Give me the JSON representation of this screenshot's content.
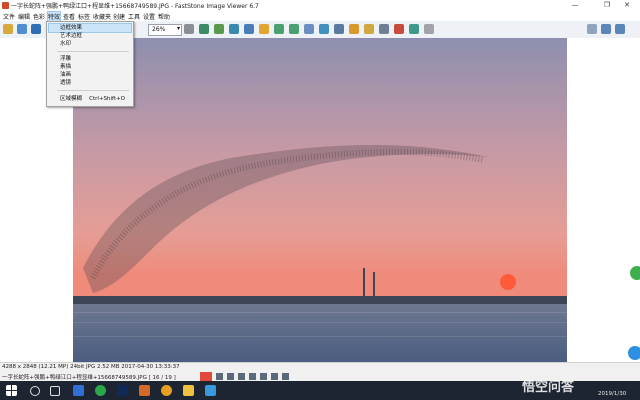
{
  "window": {
    "title": "一字长蛇阵+强鹏+鸭绿江口+程显维+15668749589.JPG  -  FastStone Image Viewer 6.7",
    "min_symbol": "—",
    "max_symbol": "❐",
    "close_symbol": "✕"
  },
  "menu": {
    "items": [
      "文件",
      "编辑",
      "色彩",
      "特效",
      "查看",
      "标签",
      "收藏夹",
      "创建",
      "工具",
      "设置",
      "帮助"
    ],
    "active": "特效"
  },
  "toolbar": {
    "zoom": "26%",
    "zoom_arrow": "▾"
  },
  "dropdown": {
    "items": [
      {
        "label": "边框效果",
        "highlighted": true
      },
      {
        "label": "艺术边框"
      },
      {
        "label": "水印"
      },
      {
        "label": "浮雕"
      },
      {
        "label": "素描"
      },
      {
        "label": "油画"
      },
      {
        "label": "透镜"
      },
      {
        "label": "区域模糊",
        "shortcut": "Ctrl+Shift+O"
      }
    ]
  },
  "status": {
    "info": "4288 x 2848 (12.21 MP)  24bit  JPG  2.52 MB  2017-04-30 13:33:37",
    "file": "一字长蛇阵+强鹏+鸭绿江口+程显维+15668749589.JPG [ 16 / 19 ]"
  },
  "taskbar": {
    "tray_time": "2019/1/30",
    "watermark": "悟空问答"
  },
  "colors": {
    "sky_top": "#8e8fb0",
    "sky_mid": "#d99b9a",
    "horizon": "#f08a7a",
    "sun": "#ff5a3a",
    "water": "#4b5d80",
    "taskbar": "#1d2532",
    "menu_highlight": "#cce4f7"
  }
}
